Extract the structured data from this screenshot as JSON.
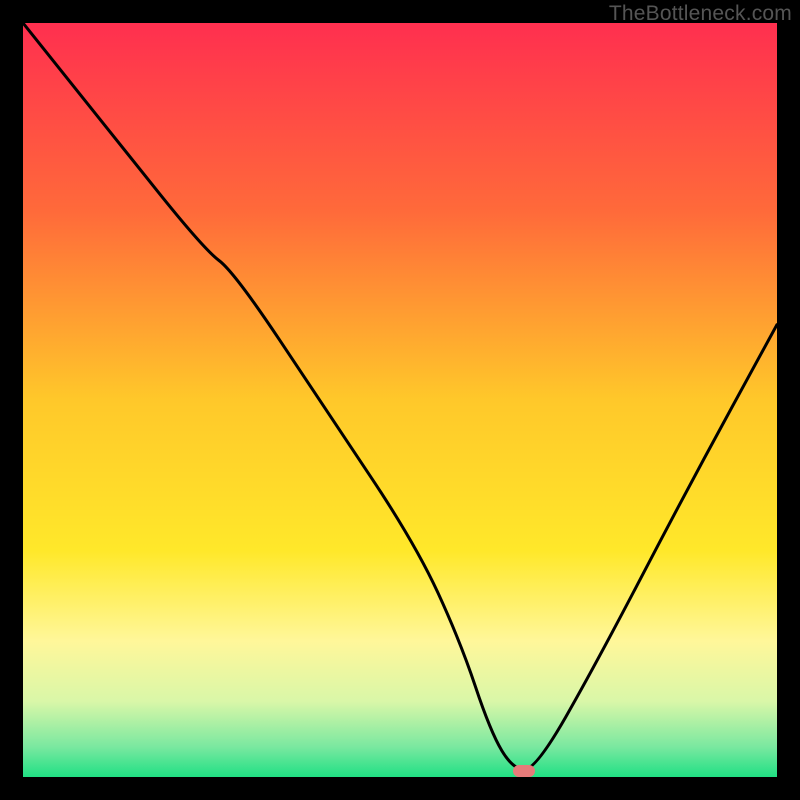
{
  "watermark": "TheBottleneck.com",
  "colors": {
    "background": "#000000",
    "gradient_top": "#ff2f4f",
    "gradient_mid1": "#ff8a2a",
    "gradient_mid2": "#ffe02a",
    "gradient_low1": "#fff79a",
    "gradient_low2": "#d9f7a8",
    "gradient_bottom": "#20e084",
    "curve": "#000000",
    "marker": "#e77b7a",
    "watermark_text": "#555555"
  },
  "chart_data": {
    "type": "line",
    "title": "",
    "xlabel": "",
    "ylabel": "",
    "xlim": [
      0,
      100
    ],
    "ylim": [
      0,
      100
    ],
    "series": [
      {
        "name": "bottleneck-curve",
        "x": [
          0,
          12,
          24,
          28,
          40,
          52,
          58,
          62,
          65,
          68,
          76,
          88,
          100
        ],
        "y": [
          100,
          85,
          70,
          67,
          49,
          31,
          18,
          6,
          1,
          1,
          15,
          38,
          60
        ]
      }
    ],
    "marker": {
      "x": 66.5,
      "y": 0.8
    },
    "gradient_stops": [
      {
        "offset": 0.0,
        "color": "#ff2f4f"
      },
      {
        "offset": 0.25,
        "color": "#ff6a3a"
      },
      {
        "offset": 0.5,
        "color": "#ffc82a"
      },
      {
        "offset": 0.7,
        "color": "#ffe82a"
      },
      {
        "offset": 0.82,
        "color": "#fff79a"
      },
      {
        "offset": 0.9,
        "color": "#d9f7a8"
      },
      {
        "offset": 0.96,
        "color": "#7ae8a0"
      },
      {
        "offset": 1.0,
        "color": "#20e084"
      }
    ]
  }
}
